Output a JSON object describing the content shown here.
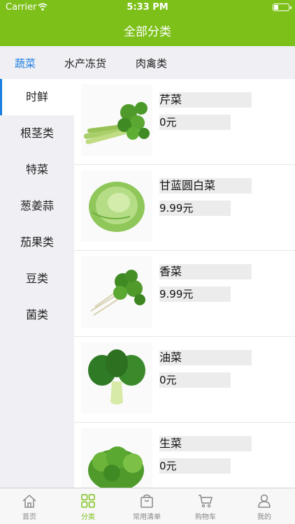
{
  "status_bar": {
    "carrier": "Carrier",
    "time": "5:33 PM"
  },
  "header": {
    "title": "全部分类"
  },
  "tabs": [
    {
      "label": "蔬菜",
      "active": true
    },
    {
      "label": "水产冻货",
      "active": false
    },
    {
      "label": "肉禽类",
      "active": false
    }
  ],
  "sidebar": {
    "items": [
      {
        "label": "时鲜",
        "active": true
      },
      {
        "label": "根茎类"
      },
      {
        "label": "特菜"
      },
      {
        "label": "葱姜蒜"
      },
      {
        "label": "茄果类"
      },
      {
        "label": "豆类"
      },
      {
        "label": "菌类"
      }
    ]
  },
  "products": [
    {
      "name": "芹菜",
      "price": "0元",
      "icon": "celery-image"
    },
    {
      "name": "甘蓝圆白菜",
      "price": "9.99元",
      "icon": "cabbage-image"
    },
    {
      "name": "香菜",
      "price": "9.99元",
      "icon": "coriander-image"
    },
    {
      "name": "油菜",
      "price": "0元",
      "icon": "bok-choy-image"
    },
    {
      "name": "生菜",
      "price": "0元",
      "icon": "lettuce-image"
    }
  ],
  "tabbar": [
    {
      "label": "首页",
      "icon": "home-icon",
      "active": false
    },
    {
      "label": "分类",
      "icon": "category-icon",
      "active": true
    },
    {
      "label": "常用清单",
      "icon": "bag-icon",
      "active": false
    },
    {
      "label": "购物车",
      "icon": "cart-icon",
      "active": false
    },
    {
      "label": "我的",
      "icon": "user-icon",
      "active": false
    }
  ],
  "colors": {
    "accent": "#7dc01a",
    "active_tab": "#1a7ee0",
    "sidebar_bg": "#efeff4"
  }
}
